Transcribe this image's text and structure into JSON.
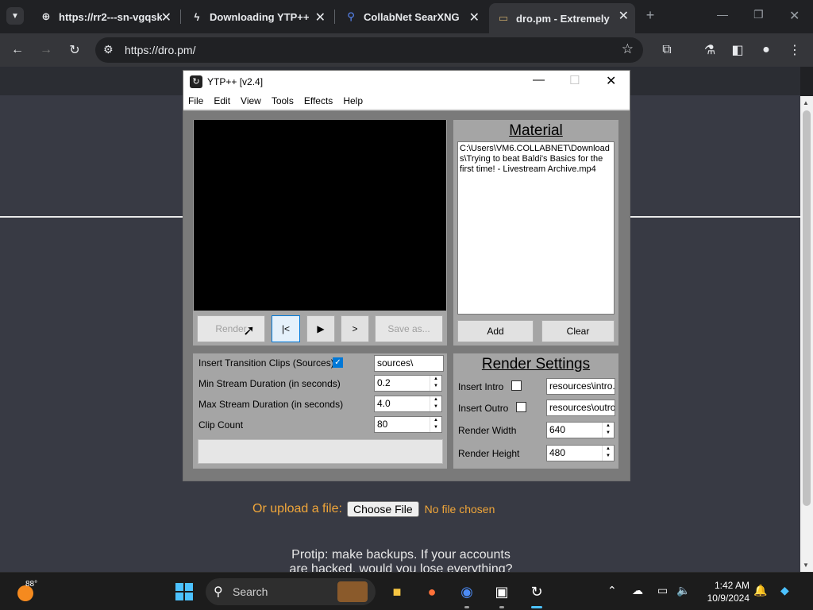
{
  "browser": {
    "tabs": [
      {
        "label": "https://rr2---sn-vgqsk",
        "icon": "globe-icon"
      },
      {
        "label": "Downloading YTP++",
        "icon": "bolt-icon"
      },
      {
        "label": "CollabNet SearXNG",
        "icon": "search-icon"
      },
      {
        "label": "dro.pm - Extremely Sh",
        "icon": "dro-icon"
      }
    ],
    "new_tab": "+",
    "url": "https://dro.pm/"
  },
  "page": {
    "upload_label": "Or upload a file:",
    "choose_file": "Choose File",
    "no_file": "No file chosen",
    "protip_line1": "Protip: make backups. If your accounts",
    "protip_line2": "are hacked, would you lose everything?"
  },
  "ytp": {
    "title": "YTP++ [v2.4]",
    "menu": [
      "File",
      "Edit",
      "View",
      "Tools",
      "Effects",
      "Help"
    ],
    "controls": {
      "render": "Render",
      "rewind": "|<",
      "play": "▶",
      "next": ">",
      "save_as": "Save as..."
    },
    "material": {
      "title": "Material",
      "items": [
        "C:\\Users\\VM6.COLLABNET\\Downloads\\Trying to beat Baldi's Basics for the first time! - Livestream Archive.mp4"
      ],
      "add": "Add",
      "clear": "Clear"
    },
    "settings": {
      "transition_label": "Insert Transition Clips (Sources)",
      "transition_value": "sources\\",
      "transition_checked": true,
      "min_label": "Min Stream Duration (in seconds)",
      "min_value": "0.2",
      "max_label": "Max Stream Duration (in seconds)",
      "max_value": "4.0",
      "count_label": "Clip Count",
      "count_value": "80"
    },
    "render_settings": {
      "title": "Render Settings",
      "intro_label": "Insert Intro",
      "intro_value": "resources\\intro.m",
      "outro_label": "Insert Outro",
      "outro_value": "resources\\outro.",
      "width_label": "Render Width",
      "width_value": "640",
      "height_label": "Render Height",
      "height_value": "480"
    }
  },
  "taskbar": {
    "temperature": "88°",
    "search_placeholder": "Search",
    "time": "1:42 AM",
    "date": "10/9/2024"
  }
}
